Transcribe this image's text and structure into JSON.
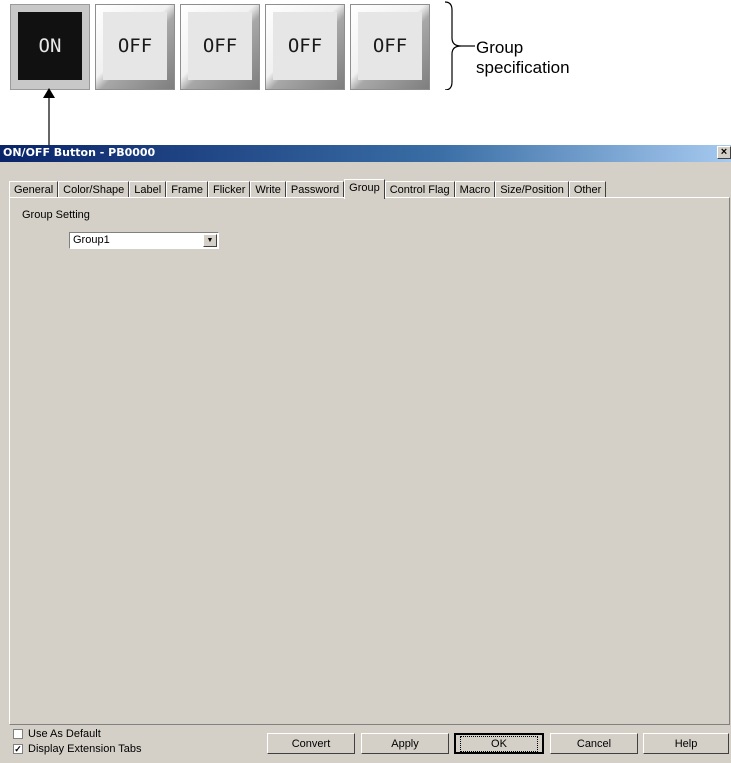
{
  "illustration": {
    "buttons": [
      {
        "label": "ON",
        "state": "on"
      },
      {
        "label": "OFF",
        "state": "off"
      },
      {
        "label": "OFF",
        "state": "off"
      },
      {
        "label": "OFF",
        "state": "off"
      },
      {
        "label": "OFF",
        "state": "off"
      }
    ],
    "group_label_line1": "Group",
    "group_label_line2": "specification"
  },
  "dialog": {
    "title": "ON/OFF Button - PB0000",
    "close_glyph": "×",
    "tabs": [
      "General",
      "Color/Shape",
      "Label",
      "Frame",
      "Flicker",
      "Write",
      "Password",
      "Group",
      "Control Flag",
      "Macro",
      "Size/Position",
      "Other"
    ],
    "active_tab": "Group",
    "group_setting_label": "Group Setting",
    "group_value": "Group1",
    "use_as_default_label": "Use As Default",
    "use_as_default_checked": false,
    "display_ext_tabs_label": "Display Extension Tabs",
    "display_ext_tabs_checked": true,
    "buttons": {
      "convert": "Convert",
      "apply": "Apply",
      "ok": "OK",
      "cancel": "Cancel",
      "help": "Help"
    }
  }
}
